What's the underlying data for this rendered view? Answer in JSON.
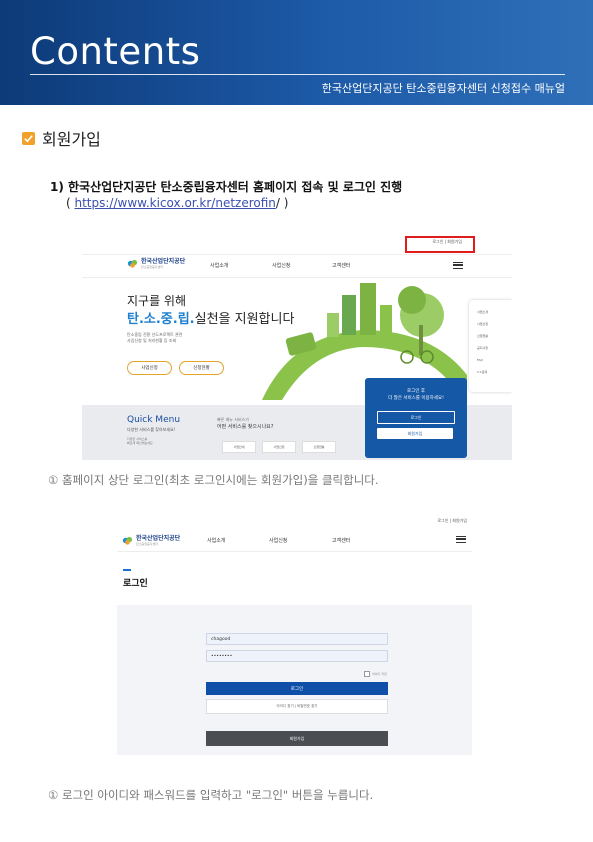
{
  "header": {
    "title": "Contents",
    "subtitle": "한국산업단지공단 탄소중립융자센터 신청접수 매뉴얼",
    "colors": {
      "banner_dark": "#0d3a78",
      "banner_light": "#2f6fb8"
    }
  },
  "section": {
    "icon": "checkbox-icon",
    "title": "회원가입"
  },
  "step1": {
    "title": "1) 한국산업단지공단 탄소중립융자센터 홈페이지 접속 및 로그인 진행",
    "url_prefix": "( ",
    "url": "https://www.kicox.or.kr/netzerofin",
    "url_suffix": "/ )"
  },
  "screenshot1": {
    "top_links": "로그인 | 회원가입",
    "logo_title": "한국산업단지공단",
    "logo_sub": "탄소중립융자센터",
    "nav": [
      "사업소개",
      "사업신청",
      "고객센터"
    ],
    "hero_line1": "지구를 위해",
    "hero_line2_prefix": "탄.소.중.립.",
    "hero_line2_suffix": "실천을 지원합니다",
    "hero_desc1": "탄소중립 전환 선도프로젝트 관련",
    "hero_desc2": "사업신청 및 처리현황 등 조회",
    "btn_apply": "사업신청",
    "btn_status": "신청현황",
    "side_items": [
      "사업소개",
      "사업신청",
      "신청현황",
      "공지사항",
      "FAQ",
      "1:1문의"
    ],
    "quick_title": "Quick Menu",
    "quick_sub": "다양한 서비스를 찾아보세요!",
    "quick_desc1": "다양한 서비스를",
    "quick_desc2": "빠르게 확인해보세요",
    "quick_q1": "빠른 메뉴 서비스가",
    "quick_q2": "어떤 서비스를 찾으시나요?",
    "quick_buttons": [
      "사업안내",
      "사업신청",
      "신청현황"
    ],
    "popup_text1": "로그인 후",
    "popup_text2": "더 많은 서비스를 이용하세요!",
    "popup_login": "로그인",
    "popup_join": "회원가입"
  },
  "caption1": "① 홈페이지 상단 로그인(최초 로그인시에는 회원가입)을 클릭합니다.",
  "screenshot2": {
    "top_links": "로그인 | 회원가입",
    "logo_title": "한국산업단지공단",
    "logo_sub": "탄소중립융자센터",
    "nav": [
      "사업소개",
      "사업신청",
      "고객센터"
    ],
    "page_title": "로그인",
    "id_value": "chagood",
    "password_value": "••••••••",
    "save_id": "아이디 저장",
    "login_button": "로그인",
    "find_links": "아이디 찾기  |  비밀번호 찾기",
    "join_button": "회원가입"
  },
  "caption2": "① 로그인 아이디와 패스워드를 입력하고 \"로그인\" 버튼을 누릅니다."
}
